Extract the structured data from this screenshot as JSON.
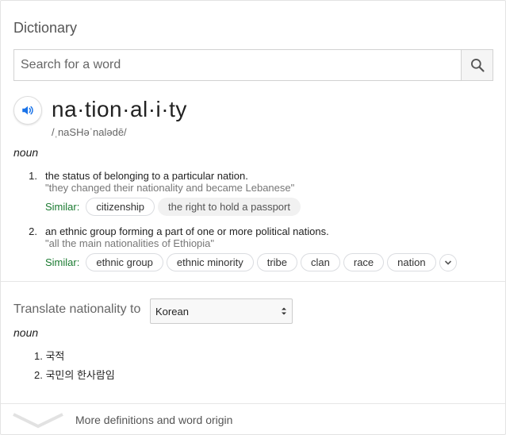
{
  "header": {
    "title": "Dictionary"
  },
  "search": {
    "placeholder": "Search for a word",
    "value": ""
  },
  "entry": {
    "word": "na·tion·al·i·ty",
    "phonetic": "/ˌnaSHəˈnalədē/",
    "part_of_speech": "noun",
    "senses": [
      {
        "number": "1.",
        "definition": "the status of belonging to a particular nation.",
        "example": "\"they changed their nationality and became Lebanese\"",
        "similar_label": "Similar:",
        "similar": [
          "citizenship",
          "the right to hold a passport"
        ]
      },
      {
        "number": "2.",
        "definition": "an ethnic group forming a part of one or more political nations.",
        "example": "\"all the main nationalities of Ethiopia\"",
        "similar_label": "Similar:",
        "similar": [
          "ethnic group",
          "ethnic minority",
          "tribe",
          "clan",
          "race",
          "nation"
        ]
      }
    ]
  },
  "translate": {
    "label": "Translate nationality to",
    "language": "Korean",
    "part_of_speech": "noun",
    "items": [
      {
        "number": "1.",
        "text": "국적"
      },
      {
        "number": "2.",
        "text": "국민의 한사람임"
      }
    ]
  },
  "footer": {
    "more_label": "More definitions and word origin"
  },
  "colors": {
    "accent_blue": "#1a73e8",
    "similar_green": "#1a7a30"
  }
}
